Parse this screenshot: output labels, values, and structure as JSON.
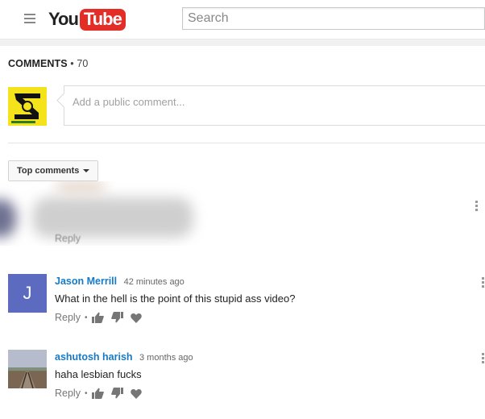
{
  "header": {
    "logo_you": "You",
    "logo_tube": "Tube",
    "search_placeholder": "Search"
  },
  "comments_section": {
    "title": "COMMENTS",
    "separator": "•",
    "count": "70",
    "composer_placeholder": "Add a public comment...",
    "sort_label": "Top comments"
  },
  "blurred_comment": {
    "reply_label": "Reply"
  },
  "comments": [
    {
      "avatar_letter": "J",
      "author": "Jason Merrill",
      "time": "42 minutes ago",
      "text": "What in the hell is the point of this stupid ass video?",
      "reply_label": "Reply",
      "dot": "•"
    },
    {
      "avatar_letter": "",
      "author": "ashutosh harish",
      "time": "3 months ago",
      "text": "haha lesbian fucks",
      "reply_label": "Reply",
      "dot": "•"
    }
  ],
  "colors": {
    "brand_red": "#e52d27",
    "author_blue": "#167ac6",
    "avatar_indigo": "#5c6bc0"
  },
  "icons": [
    "menu-icon",
    "like-icon",
    "dislike-icon",
    "heart-icon",
    "more-vert-icon"
  ]
}
